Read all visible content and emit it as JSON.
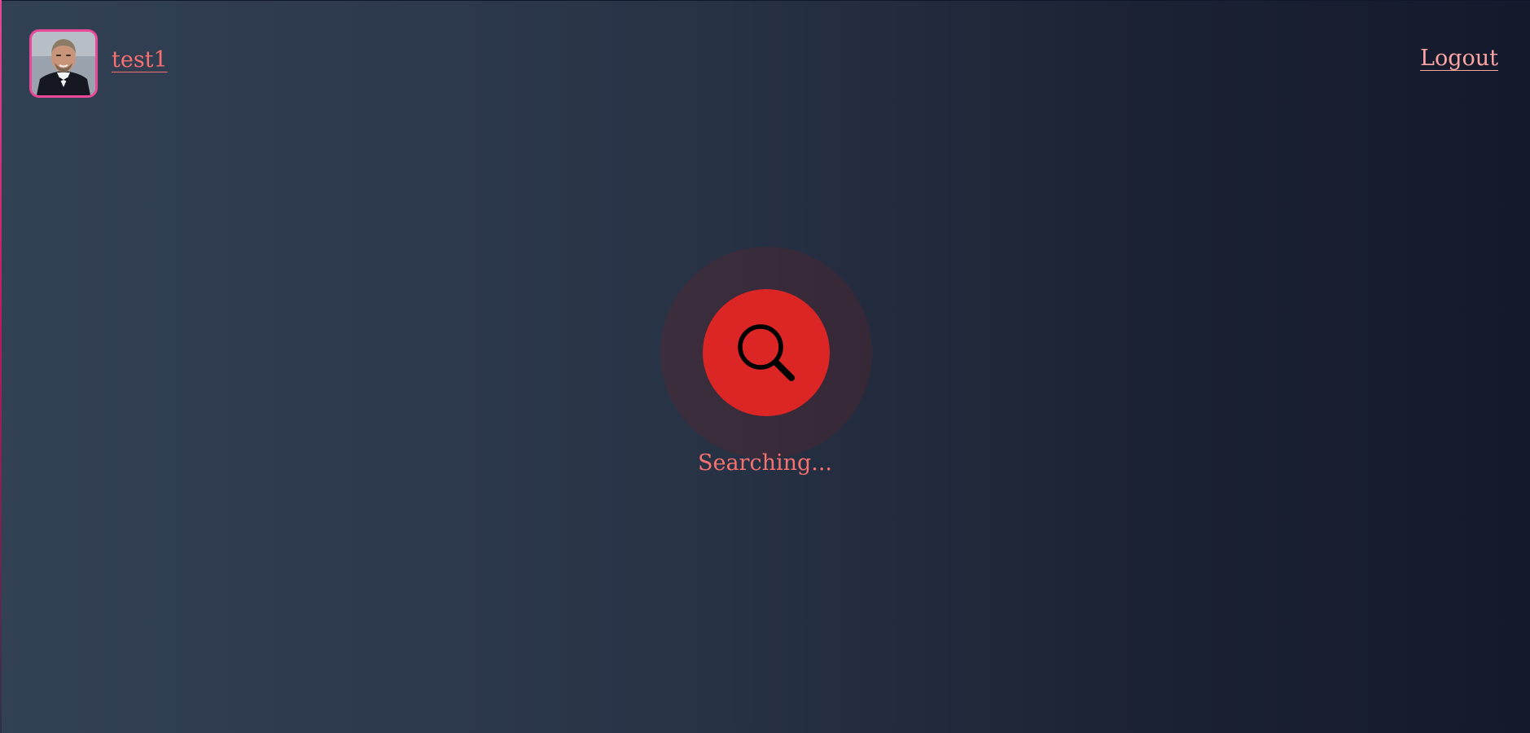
{
  "header": {
    "username": "test1",
    "logout_label": "Logout"
  },
  "search": {
    "status_text": "Searching..."
  },
  "icons": {
    "avatar": "user-avatar-photo",
    "search": "search-icon"
  },
  "colors": {
    "accent": "#f87171",
    "avatar_border": "#ec4899",
    "search_button": "#dc2626",
    "background_left": "#334155",
    "background_right": "#141a2b"
  }
}
